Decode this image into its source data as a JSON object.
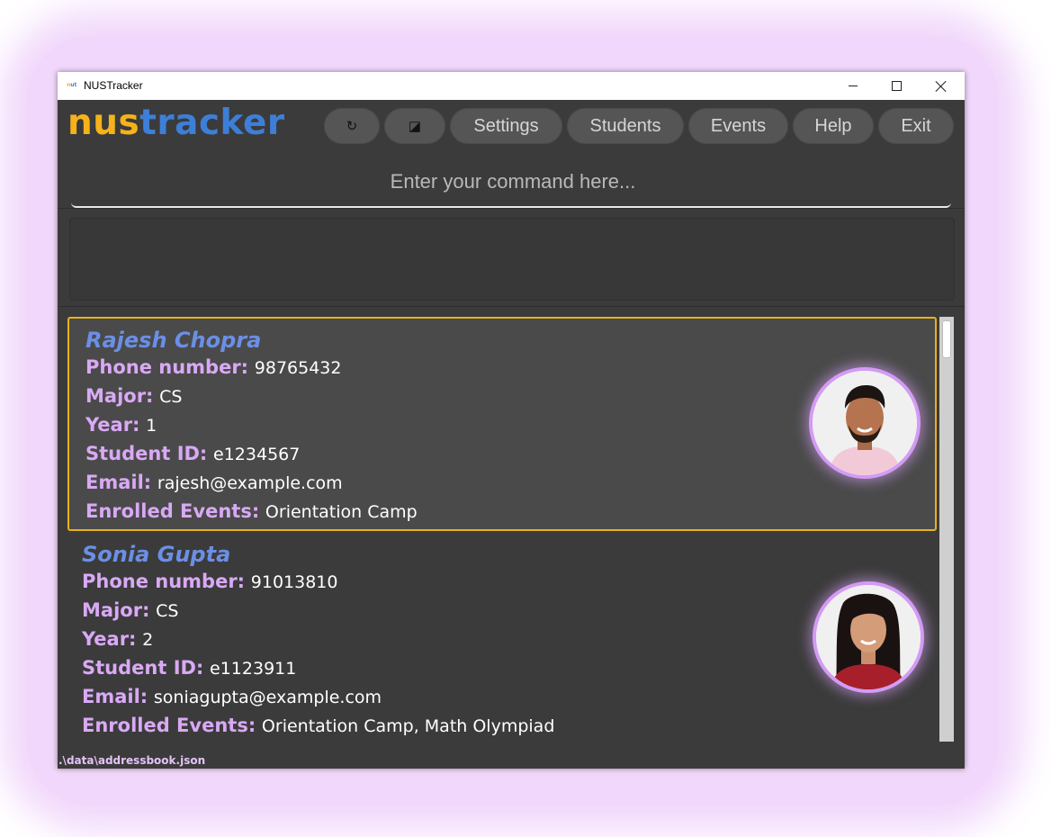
{
  "window": {
    "title": "NUSTracker"
  },
  "logo": {
    "part1": "nus",
    "part2": "tracker"
  },
  "toolbar": {
    "refresh_icon": "↻",
    "theme_icon": "◪",
    "settings_label": "Settings",
    "students_label": "Students",
    "events_label": "Events",
    "help_label": "Help",
    "exit_label": "Exit"
  },
  "command": {
    "placeholder": "Enter your command here...",
    "value": ""
  },
  "result": {
    "text": ""
  },
  "labels": {
    "phone": "Phone number:",
    "major": "Major:",
    "year": "Year:",
    "student_id": "Student ID:",
    "email": "Email:",
    "events": "Enrolled Events:"
  },
  "students": [
    {
      "name": "Rajesh Chopra",
      "phone": "98765432",
      "major": "CS",
      "year": "1",
      "student_id": "e1234567",
      "email": "rajesh@example.com",
      "events": "Orientation Camp",
      "selected": true
    },
    {
      "name": "Sonia Gupta",
      "phone": "91013810",
      "major": "CS",
      "year": "2",
      "student_id": "e1123911",
      "email": "soniagupta@example.com",
      "events": "Orientation Camp, Math Olympiad",
      "selected": false
    }
  ],
  "status": {
    "file_path": ".\\data\\addressbook.json"
  },
  "colors": {
    "accent_gold": "#f5b21b",
    "accent_blue": "#3d7fd8",
    "label_purple": "#d9a9f5",
    "name_blue": "#6b8fe6",
    "background": "#3b3b3b"
  }
}
